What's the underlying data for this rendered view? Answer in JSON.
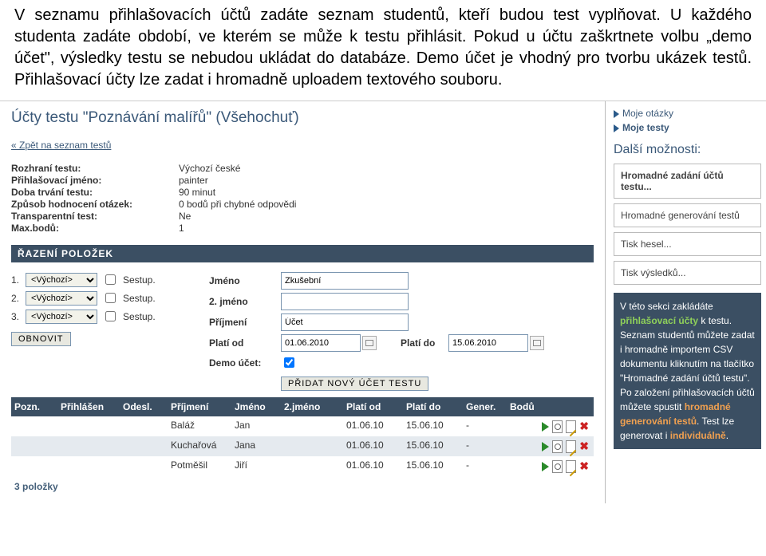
{
  "intro": {
    "text": "V seznamu přihlašovacích účtů zadáte seznam studentů, kteří budou test vyplňovat. U každého studenta zadáte období, ve kterém se může k testu přihlásit. Pokud u účtu zaškrtnete volbu „demo účet\", výsledky testu se nebudou ukládat do databáze. Demo účet je vhodný pro tvorbu ukázek testů. Přihlašovací účty lze zadat i hromadně uploadem textového souboru."
  },
  "page": {
    "title": "Účty testu \"Poznávání malířů\" (Všehochuť)",
    "back_link": "« Zpět na seznam testů"
  },
  "info": {
    "rows": [
      {
        "label": "Rozhraní testu:",
        "value": "Výchozí české"
      },
      {
        "label": "Přihlašovací jméno:",
        "value": "painter"
      },
      {
        "label": "Doba trvání testu:",
        "value": "90 minut"
      },
      {
        "label": "Způsob hodnocení otázek:",
        "value": "0 bodů při chybné odpovědi"
      },
      {
        "label": "Transparentní test:",
        "value": "Ne"
      },
      {
        "label": "Max.bodů:",
        "value": "1"
      }
    ]
  },
  "sort": {
    "header": "ŘAZENÍ POLOŽEK",
    "default_option": "<Výchozí>",
    "descending": "Sestup.",
    "refresh": "OBNOVIT"
  },
  "form": {
    "jmeno_label": "Jméno",
    "jmeno_value": "Zkušební",
    "jmeno2_label": "2. jméno",
    "prijmeni_label": "Příjmení",
    "prijmeni_value": "Účet",
    "plati_od_label": "Platí od",
    "plati_od_value": "01.06.2010",
    "plati_do_label": "Platí do",
    "plati_do_value": "15.06.2010",
    "demo_label": "Demo účet:",
    "add_button": "PŘIDAT NOVÝ ÚČET TESTU"
  },
  "table": {
    "headers": {
      "pozn": "Pozn.",
      "prihl": "Přihlášen",
      "odesl": "Odesl.",
      "prij": "Příjmení",
      "jmeno": "Jméno",
      "jmeno2": "2.jméno",
      "plod": "Platí od",
      "pldo": "Platí do",
      "gener": "Gener.",
      "bodu": "Bodů"
    },
    "rows": [
      {
        "prij": "Baláž",
        "jmeno": "Jan",
        "plod": "01.06.10",
        "pldo": "15.06.10",
        "gener": "-"
      },
      {
        "prij": "Kuchařová",
        "jmeno": "Jana",
        "plod": "01.06.10",
        "pldo": "15.06.10",
        "gener": "-"
      },
      {
        "prij": "Potměšil",
        "jmeno": "Jiří",
        "plod": "01.06.10",
        "pldo": "15.06.10",
        "gener": "-"
      }
    ],
    "footer": "3 položky"
  },
  "sidebar": {
    "links": {
      "otazky": "Moje otázky",
      "testy": "Moje testy"
    },
    "heading": "Další možnosti:",
    "buttons": {
      "hromadne_ucty": "Hromadné zadání účtů testu...",
      "hromadne_gen": "Hromadné generování testů",
      "tisk_hesel": "Tisk hesel...",
      "tisk_vysledku": "Tisk výsledků..."
    },
    "infobox": {
      "t1": "V této sekci zakládáte ",
      "hl1": "přihlašovací účty",
      "t2": " k testu. Seznam studentů můžete zadat i hromadně importem CSV dokumentu kliknutím na tlačítko \"Hromadné zadání účtů testu\". Po založení přihlašovacích účtů můžete spustit ",
      "hl2": "hromadné generování testů",
      "t3": ". Test lze generovat i ",
      "hl3": "individuálně"
    }
  }
}
